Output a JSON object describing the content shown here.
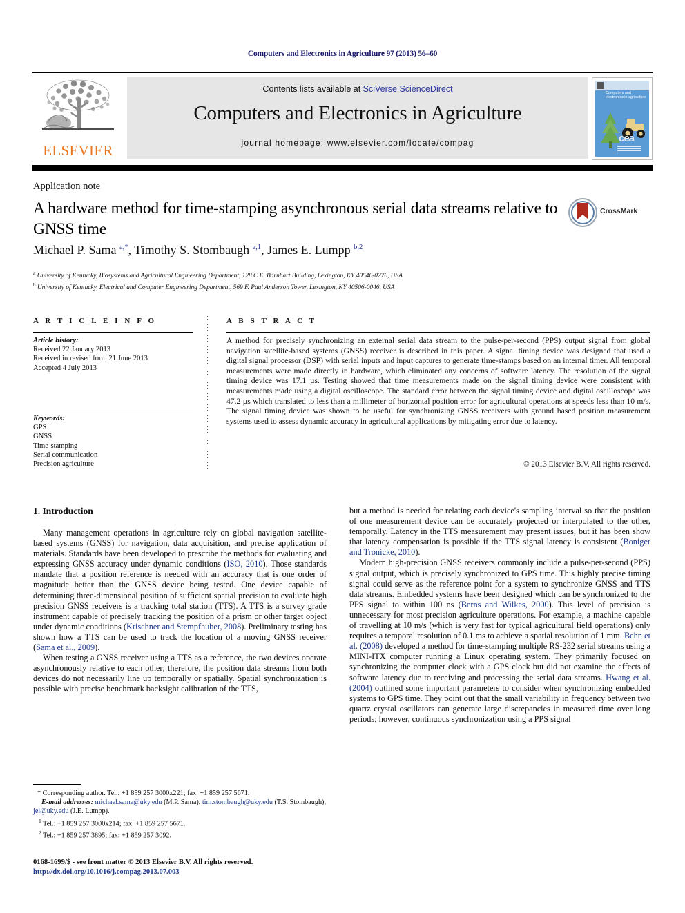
{
  "running_head": "Computers and Electronics in Agriculture 97 (2013) 56–60",
  "masthead": {
    "contents_prefix": "Contents lists available at ",
    "sciencedirect": "SciVerse ScienceDirect",
    "journal_title": "Computers and Electronics in Agriculture",
    "homepage": "journal homepage: www.elsevier.com/locate/compag",
    "publisher_logo_text": "ELSEVIER",
    "cover_title": "Computers and electronics in agriculture",
    "cover_abbrev": "cea",
    "accent_orange": "#E87722",
    "link_blue": "#2b3a9c",
    "cover_blue": "#5b9bd5"
  },
  "article": {
    "type": "Application note",
    "title": "A hardware method for time-stamping asynchronous serial data streams relative to GNSS time",
    "crossmark_label": "CrossMark",
    "authors_html": "Michael P. Sama <sup>a,*</sup>, Timothy S. Stombaugh <sup>a,1</sup>, James E. Lumpp <sup>b,2</sup>",
    "affiliation_a": "University of Kentucky, Biosystems and Agricultural Engineering Department, 128 C.E. Barnhart Building, Lexington, KY 40546-0276, USA",
    "affiliation_b": "University of Kentucky, Electrical and Computer Engineering Department, 569 F. Paul Anderson Tower, Lexington, KY 40506-0046, USA"
  },
  "article_info": {
    "heading": "A R T I C L E    I N F O",
    "history_label": "Article history:",
    "history": [
      "Received 22 January 2013",
      "Received in revised form 21 June 2013",
      "Accepted 4 July 2013"
    ],
    "keywords_label": "Keywords:",
    "keywords": [
      "GPS",
      "GNSS",
      "Time-stamping",
      "Serial communication",
      "Precision agriculture"
    ]
  },
  "abstract": {
    "heading": "A B S T R A C T",
    "text": "A method for precisely synchronizing an external serial data stream to the pulse-per-second (PPS) output signal from global navigation satellite-based systems (GNSS) receiver is described in this paper. A signal timing device was designed that used a digital signal processor (DSP) with serial inputs and input captures to generate time-stamps based on an internal timer. All temporal measurements were made directly in hardware, which eliminated any concerns of software latency. The resolution of the signal timing device was 17.1 µs. Testing showed that time measurements made on the signal timing device were consistent with measurements made using a digital oscilloscope. The standard error between the signal timing device and digital oscilloscope was 47.2 µs which translated to less than a millimeter of horizontal position error for agricultural operations at speeds less than 10 m/s. The signal timing device was shown to be useful for synchronizing GNSS receivers with ground based position measurement systems used to assess dynamic accuracy in agricultural applications by mitigating error due to latency.",
    "copyright": "© 2013 Elsevier B.V. All rights reserved."
  },
  "body": {
    "section_heading": "1. Introduction",
    "left_paragraphs": [
      "Many management operations in agriculture rely on global navigation satellite-based systems (GNSS) for navigation, data acquisition, and precise application of materials. Standards have been developed to prescribe the methods for evaluating and expressing GNSS accuracy under dynamic conditions (ISO, 2010). Those standards mandate that a position reference is needed with an accuracy that is one order of magnitude better than the GNSS device being tested. One device capable of determining three-dimensional position of sufficient spatial precision to evaluate high precision GNSS receivers is a tracking total station (TTS). A TTS is a survey grade instrument capable of precisely tracking the position of a prism or other target object under dynamic conditions (Krischner and Stempfhuber, 2008). Preliminary testing has shown how a TTS can be used to track the location of a moving GNSS receiver (Sama et al., 2009).",
      "When testing a GNSS receiver using a TTS as a reference, the two devices operate asynchronously relative to each other; therefore, the position data streams from both devices do not necessarily line up temporally or spatially. Spatial synchronization is possible with precise benchmark backsight calibration of the TTS,"
    ],
    "right_paragraphs": [
      "but a method is needed for relating each device's sampling interval so that the position of one measurement device can be accurately projected or interpolated to the other, temporally. Latency in the TTS measurement may present issues, but it has been show that latency compensation is possible if the TTS signal latency is consistent (Boniger and Tronicke, 2010).",
      "Modern high-precision GNSS receivers commonly include a pulse-per-second (PPS) signal output, which is precisely synchronized to GPS time. This highly precise timing signal could serve as the reference point for a system to synchronize GNSS and TTS data streams. Embedded systems have been designed which can be synchronized to the PPS signal to within 100 ns (Berns and Wilkes, 2000). This level of precision is unnecessary for most precision agriculture operations. For example, a machine capable of travelling at 10 m/s (which is very fast for typical agricultural field operations) only requires a temporal resolution of 0.1 ms to achieve a spatial resolution of 1 mm. Behn et al. (2008) developed a method for time-stamping multiple RS-232 serial streams using a MINI-ITX computer running a Linux operating system. They primarily focused on synchronizing the computer clock with a GPS clock but did not examine the effects of software latency due to receiving and processing the serial data streams. Hwang et al. (2004) outlined some important parameters to consider when synchronizing embedded systems to GPS time. They point out that the small variability in frequency between two quartz crystal oscillators can generate large discrepancies in measured time over long periods; however, continuous synchronization using a PPS signal"
    ],
    "references_inline": [
      "ISO, 2010",
      "Krischner and Stempfhuber, 2008",
      "Sama et al., 2009",
      "Boniger and Tronicke, 2010",
      "Berns and Wilkes, 2000",
      "Behn et al. (2008)",
      "Hwang et al. (2004)"
    ]
  },
  "footnotes": {
    "corresponding": "* Corresponding author. Tel.: +1 859 257 3000x221; fax: +1 859 257 5671.",
    "email_label": "E-mail addresses:",
    "emails": [
      {
        "address": "michael.sama@uky.edu",
        "owner": "(M.P. Sama)"
      },
      {
        "address": "tim.stombaugh@uky.edu",
        "owner": "(T.S. Stombaugh)"
      },
      {
        "address": "jel@uky.edu",
        "owner": "(J.E. Lumpp)"
      }
    ],
    "note1": "Tel.: +1 859 257 3000x214; fax: +1 859 257 5671.",
    "note2": "Tel.: +1 859 257 3895; fax: +1 859 257 3092.",
    "note1_marker": "1",
    "note2_marker": "2"
  },
  "colophon": {
    "issn_line": "0168-1699/$ - see front matter © 2013 Elsevier B.V. All rights reserved.",
    "doi": "http://dx.doi.org/10.1016/j.compag.2013.07.003"
  }
}
